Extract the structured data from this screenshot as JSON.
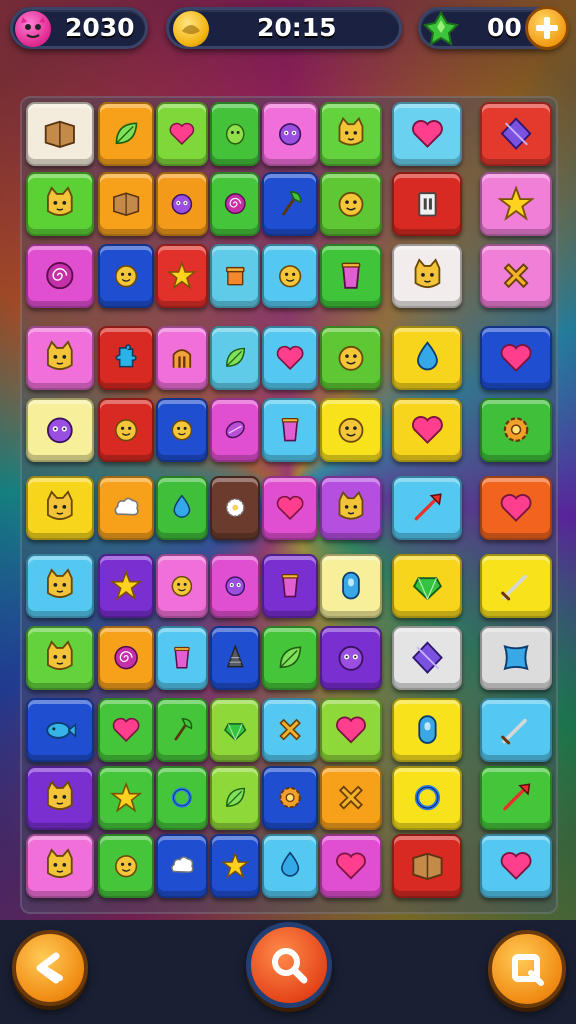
{
  "hud": {
    "score": "2030",
    "timer": "20:15",
    "gems": "00",
    "score_icon": "pink-creature-icon",
    "timer_icon": "gold-coin-icon",
    "gems_icon": "green-gem-icon",
    "add_icon": "plus-icon"
  },
  "controls": {
    "back_icon": "back-arrow-icon",
    "search_icon": "magnifier-icon",
    "frame_icon": "square-frame-icon"
  },
  "board": {
    "rows": [
      [
        {
          "c": "#f3ecdc",
          "i": "book"
        },
        {
          "c": "#f7a11b",
          "i": "leaf"
        },
        {
          "c": "#7fd83a",
          "i": "heart"
        },
        {
          "c": "#43c23a",
          "i": "blob"
        },
        {
          "c": "#f06fd9",
          "i": "creature"
        },
        {
          "c": "#63d23c",
          "i": "cat"
        },
        {
          "c": "#6ad2f0",
          "i": "heart"
        },
        {
          "c": "#e33a2e",
          "i": "diamond"
        }
      ],
      [
        {
          "c": "#5bd136",
          "i": "cat"
        },
        {
          "c": "#f7a11b",
          "i": "book"
        },
        {
          "c": "#f39a1a",
          "i": "creature"
        },
        {
          "c": "#45c53a",
          "i": "spiral"
        },
        {
          "c": "#1f4fd0",
          "i": "axe"
        },
        {
          "c": "#5ec834",
          "i": "face"
        },
        {
          "c": "#d82a22",
          "i": "tower"
        },
        {
          "c": "#f07fd8",
          "i": "star"
        }
      ],
      [
        {
          "c": "#e14fd1",
          "i": "spiral"
        },
        {
          "c": "#1f4fd0",
          "i": "face"
        },
        {
          "c": "#e2302a",
          "i": "star"
        },
        {
          "c": "#5fcbe8",
          "i": "box"
        },
        {
          "c": "#54c8f0",
          "i": "face"
        },
        {
          "c": "#40c43a",
          "i": "cup"
        },
        {
          "c": "#f2ecec",
          "i": "cat"
        },
        {
          "c": "#f07fd8",
          "i": "cross"
        }
      ],
      [
        {
          "c": "#f06fd9",
          "i": "cat"
        },
        {
          "c": "#d82a22",
          "i": "puzzle"
        },
        {
          "c": "#f06fd9",
          "i": "gate"
        },
        {
          "c": "#5fcbe8",
          "i": "leaf"
        },
        {
          "c": "#54c8f0",
          "i": "heart"
        },
        {
          "c": "#5ec834",
          "i": "face"
        },
        {
          "c": "#f7d51c",
          "i": "drop"
        },
        {
          "c": "#1f4fd0",
          "i": "heart"
        }
      ],
      [
        {
          "c": "#f7ef9a",
          "i": "creature"
        },
        {
          "c": "#d82a22",
          "i": "face"
        },
        {
          "c": "#1f4fd0",
          "i": "face"
        },
        {
          "c": "#e14fd1",
          "i": "disc"
        },
        {
          "c": "#54c8f0",
          "i": "cup"
        },
        {
          "c": "#f7e21c",
          "i": "face"
        },
        {
          "c": "#f7d51c",
          "i": "heart"
        },
        {
          "c": "#3fbf3a",
          "i": "gear"
        }
      ],
      [
        {
          "c": "#f7d51c",
          "i": "cat"
        },
        {
          "c": "#f7a11b",
          "i": "cloud"
        },
        {
          "c": "#3fbf3a",
          "i": "drop"
        },
        {
          "c": "#6b3b2e",
          "i": "flower"
        },
        {
          "c": "#e14fd1",
          "i": "heart"
        },
        {
          "c": "#b44fe0",
          "i": "cat"
        },
        {
          "c": "#54c8f0",
          "i": "arrow"
        },
        {
          "c": "#f0641e",
          "i": "heart"
        }
      ],
      [
        {
          "c": "#54c8f0",
          "i": "cat"
        },
        {
          "c": "#7a2fd1",
          "i": "star"
        },
        {
          "c": "#f06fd9",
          "i": "face"
        },
        {
          "c": "#e14fd1",
          "i": "creature"
        },
        {
          "c": "#7a2fd1",
          "i": "cup"
        },
        {
          "c": "#f7ef9a",
          "i": "capsule"
        },
        {
          "c": "#f7d51c",
          "i": "gem"
        },
        {
          "c": "#f7e21c",
          "i": "sword"
        }
      ],
      [
        {
          "c": "#63d23c",
          "i": "cat"
        },
        {
          "c": "#f7a11b",
          "i": "spiral"
        },
        {
          "c": "#54c8f0",
          "i": "cup"
        },
        {
          "c": "#1f4fd0",
          "i": "cone"
        },
        {
          "c": "#45c53a",
          "i": "leaf"
        },
        {
          "c": "#7a2fd1",
          "i": "creature"
        },
        {
          "c": "#e4e4e4",
          "i": "diamond"
        },
        {
          "c": "#dcdcdc",
          "i": "pillow"
        }
      ],
      [
        {
          "c": "#1f4fd0",
          "i": "fish"
        },
        {
          "c": "#45c53a",
          "i": "heart"
        },
        {
          "c": "#45c53a",
          "i": "axe"
        },
        {
          "c": "#8fd83a",
          "i": "gem"
        },
        {
          "c": "#54c8f0",
          "i": "cross"
        },
        {
          "c": "#8fd83a",
          "i": "heart"
        },
        {
          "c": "#f7e21c",
          "i": "capsule"
        },
        {
          "c": "#54c8f0",
          "i": "sword"
        }
      ],
      [
        {
          "c": "#7a2fd1",
          "i": "cat"
        },
        {
          "c": "#45c53a",
          "i": "star"
        },
        {
          "c": "#45c53a",
          "i": "ring"
        },
        {
          "c": "#8fd83a",
          "i": "leaf"
        },
        {
          "c": "#1f4fd0",
          "i": "gear"
        },
        {
          "c": "#f7a11b",
          "i": "cross"
        },
        {
          "c": "#f7e21c",
          "i": "ring"
        },
        {
          "c": "#45c53a",
          "i": "arrow"
        }
      ],
      [
        {
          "c": "#f06fd9",
          "i": "cat"
        },
        {
          "c": "#45c53a",
          "i": "face"
        },
        {
          "c": "#1f4fd0",
          "i": "cloud"
        },
        {
          "c": "#1f4fd0",
          "i": "star"
        },
        {
          "c": "#54c8f0",
          "i": "drop"
        },
        {
          "c": "#e14fd1",
          "i": "heart"
        },
        {
          "c": "#d82a22",
          "i": "book"
        },
        {
          "c": "#54c8f0",
          "i": "heart"
        }
      ]
    ]
  }
}
